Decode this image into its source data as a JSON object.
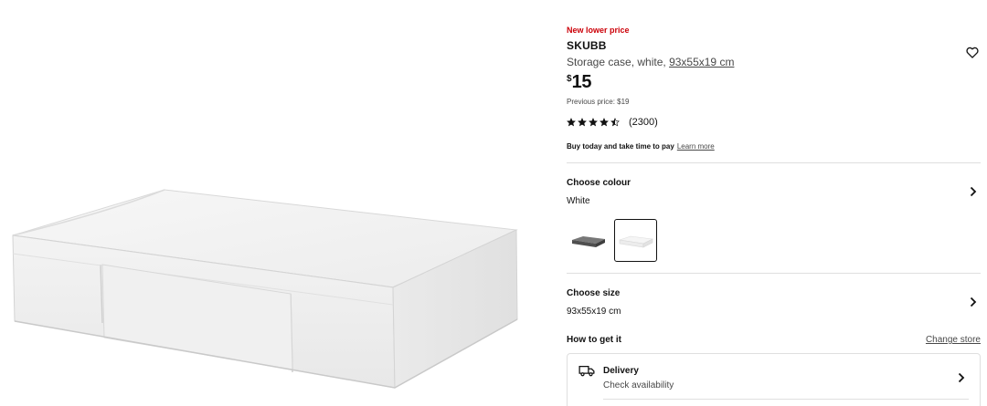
{
  "product": {
    "badge": "New lower price",
    "name": "SKUBB",
    "description": "Storage case, white, ",
    "dimensions_link": "93x55x19 cm",
    "price_currency": "$",
    "price_amount": "15",
    "previous_price": "Previous price: $19",
    "rating_value": 4.5,
    "rating_max": 5,
    "review_count": "(2300)",
    "pay_text": "Buy today and take time to pay",
    "learn_more": "Learn more"
  },
  "favourite": {
    "icon": "heart-icon"
  },
  "colour": {
    "title": "Choose colour",
    "selected": "White",
    "options": [
      {
        "name": "dark grey",
        "color": "#5a5a5a",
        "selected": false
      },
      {
        "name": "white",
        "color": "#f2f2f2",
        "selected": true
      }
    ]
  },
  "size": {
    "title": "Choose size",
    "selected": "93x55x19 cm"
  },
  "get_it": {
    "title": "How to get it",
    "change_store": "Change store",
    "delivery_title": "Delivery",
    "delivery_sub": "Check availability",
    "delivery_icon": "truck-icon"
  },
  "colors": {
    "badge_red": "#cc0008",
    "text": "#111111",
    "muted": "#484848",
    "divider": "#dfdfdf"
  }
}
